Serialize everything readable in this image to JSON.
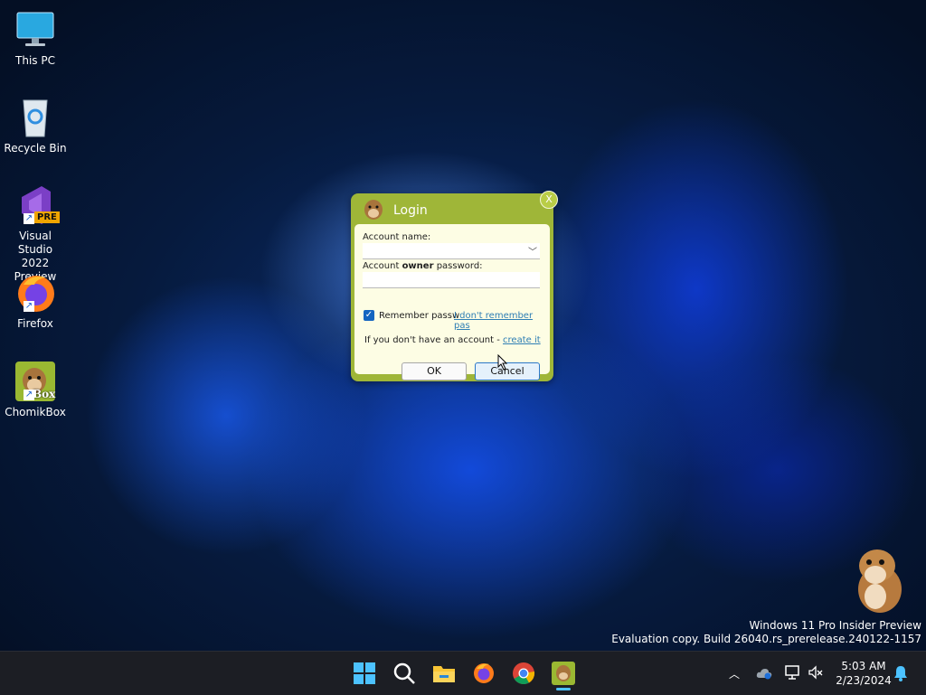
{
  "desktop": {
    "icons": [
      {
        "label": "This PC",
        "icon": "monitor-icon"
      },
      {
        "label": "Recycle Bin",
        "icon": "recycle-bin-icon"
      },
      {
        "label": "Visual Studio 2022 Preview",
        "icon": "visual-studio-icon",
        "badge": "PRE"
      },
      {
        "label": "Firefox",
        "icon": "firefox-icon"
      },
      {
        "label": "ChomikBox",
        "icon": "chomikbox-icon",
        "badge": "Box"
      }
    ],
    "watermark": {
      "line1": "Windows 11 Pro Insider Preview",
      "line2": "Evaluation copy. Build 26040.rs_prerelease.240122-1157"
    }
  },
  "login_dialog": {
    "title": "Login",
    "close_label": "X",
    "account_name_label": "Account name:",
    "account_name_value": "",
    "owner_password_label_prefix": "Account ",
    "owner_password_label_bold": "owner",
    "owner_password_label_suffix": " password:",
    "owner_password_value": "",
    "remember_checked": true,
    "remember_label": "Remember passw",
    "forgot_link": "I don't remember pas",
    "no_account_text": "If you don't have an account - ",
    "create_link": "create it",
    "ok_label": "OK",
    "cancel_label": "Cancel"
  },
  "taskbar": {
    "items": [
      "start-icon",
      "search-icon",
      "file-explorer-icon",
      "firefox-icon",
      "chrome-icon",
      "chomikbox-icon"
    ],
    "tray": {
      "time": "5:03 AM",
      "date": "2/23/2024"
    }
  },
  "colors": {
    "dialog_green": "#9fb638",
    "dialog_body": "#fdfde4",
    "link_blue": "#2e7eb4",
    "taskbar_bg": "#1c1e24",
    "checkbox_blue": "#1565c0"
  }
}
